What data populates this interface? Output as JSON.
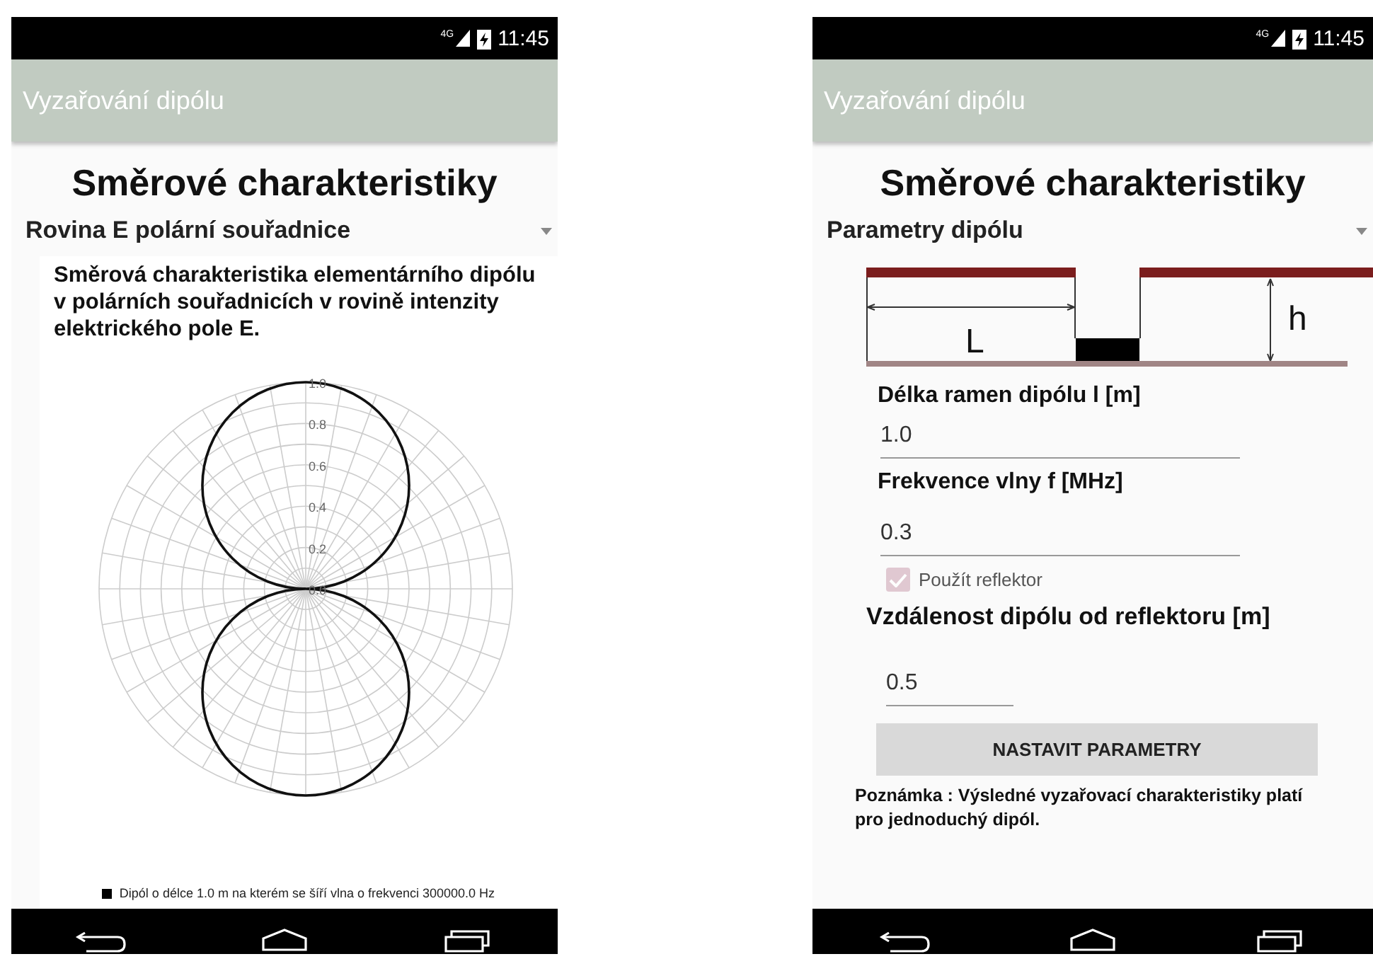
{
  "screens": [
    {
      "kind": "chart",
      "status_bar": {
        "network": "4G",
        "time": "11:45"
      },
      "app_bar": {
        "title": "Vyzařování dipólu"
      },
      "heading": "Směrové charakteristiky",
      "dropdown": {
        "value": "Rovina E polární souřadnice"
      },
      "chart": {
        "title": "Směrová charakteristika elementárního dipólu v polárních souřadnicích v rovině intenzity elektrického pole E.",
        "radial_ticks": [
          "1.0",
          "0.8",
          "0.6",
          "0.4",
          "0.2",
          "0.0"
        ],
        "legend": "Dipól o délce 1.0 m na kterém se šíří vlna o frekvenci 300000.0 Hz"
      }
    },
    {
      "kind": "form",
      "status_bar": {
        "network": "4G",
        "time": "11:45"
      },
      "app_bar": {
        "title": "Vyzařování dipólu"
      },
      "heading": "Směrové charakteristiky",
      "dropdown": {
        "value": "Parametry dipólu"
      },
      "diagram": {
        "length_label": "L",
        "height_label": "h"
      },
      "form_items": [
        {
          "kind": "field",
          "label": "Délka ramen dipólu l [m]",
          "value": "1.0"
        },
        {
          "kind": "field",
          "label": "Frekvence vlny f [MHz]",
          "value": "0.3"
        },
        {
          "kind": "checkbox",
          "label": "Použít reflektor",
          "checked": true,
          "disabled": true
        },
        {
          "kind": "field",
          "label": "Vzdálenost dipólu od reflektoru [m]",
          "value": "0.5"
        }
      ],
      "button": "NASTAVIT PARAMETRY",
      "note": "Poznámka : Výsledné vyzařovací charakteristiky platí pro jednoduchý dipól."
    }
  ]
}
